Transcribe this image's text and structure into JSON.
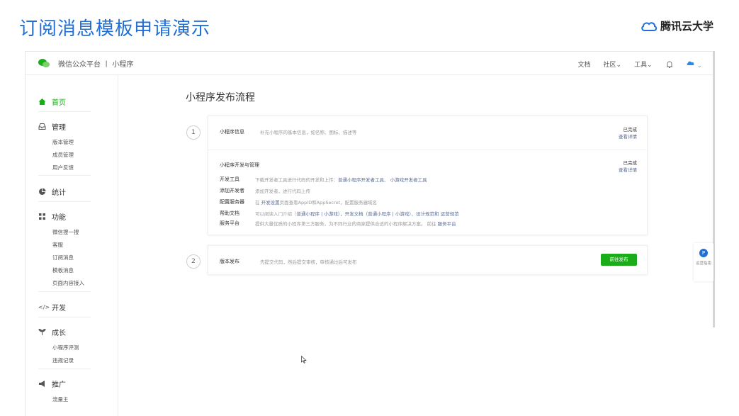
{
  "slide": {
    "title": "订阅消息模板申请演示",
    "brand": "腾讯云大学"
  },
  "app": {
    "platform_title": "微信公众平台 丨 小程序",
    "nav": {
      "docs": "文档",
      "community": "社区",
      "tools": "工具"
    }
  },
  "sidebar": {
    "home": "首页",
    "manage": {
      "label": "管理",
      "items": [
        "版本管理",
        "成员管理",
        "用户反馈"
      ]
    },
    "stats": "统计",
    "features": {
      "label": "功能",
      "items": [
        "微信搜一搜",
        "客服",
        "订阅消息",
        "模板消息",
        "页面内容接入"
      ]
    },
    "dev": "开发",
    "growth": {
      "label": "成长",
      "items": [
        "小程序评测",
        "违规记录"
      ]
    },
    "promo": {
      "label": "推广",
      "items": [
        "流量主"
      ]
    }
  },
  "main": {
    "title": "小程序发布流程",
    "step1": {
      "number": "1",
      "info": {
        "label": "小程序信息",
        "desc": "补充小程序的基本信息，如名称、图标、描述等",
        "status": "已完成",
        "link": "查看详情"
      },
      "dev": {
        "label": "小程序开发与管理",
        "status": "已完成",
        "link": "查看详情",
        "rows": [
          {
            "key": "开发工具",
            "pre": "下载开发者工具进行代码的开发和上传：",
            "hl": "普通小程序开发者工具、 小游戏开发者工具",
            "post": ""
          },
          {
            "key": "添加开发者",
            "pre": "添加开发者，进行代码上传",
            "hl": "",
            "post": ""
          },
          {
            "key": "配置服务器",
            "pre": "在 ",
            "hl": "开发设置",
            "post": "页面查看AppID和AppSecret，配置服务器域名"
          },
          {
            "key": "帮助文档",
            "pre": "可以阅读入门介绍（",
            "hl": "普通小程序 | 小游戏",
            "post": "），开发文档（普通小程序 | 小游戏）、设计规范和 运营规范"
          },
          {
            "key": "服务平台",
            "pre": "提供大量优质的小程序第三方服务，为不同行业的商家提供合适的小程序解决方案。 前往 ",
            "hl": "服务平台",
            "post": ""
          }
        ]
      }
    },
    "step2": {
      "number": "2",
      "label": "版本发布",
      "desc": "先提交代码，然后提交审核，审核通过后可发布",
      "button": "前往发布"
    }
  },
  "floater": {
    "badge": "P",
    "text": "运营指南"
  }
}
